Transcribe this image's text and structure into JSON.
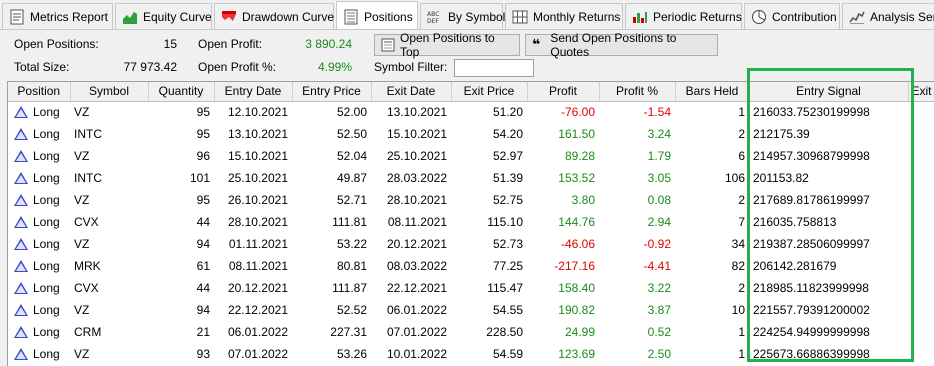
{
  "tabs": [
    {
      "label": "Metrics Report",
      "icon": "report-icon"
    },
    {
      "label": "Equity Curve",
      "icon": "equity-curve-icon"
    },
    {
      "label": "Drawdown Curve",
      "icon": "drawdown-curve-icon"
    },
    {
      "label": "Positions",
      "icon": "positions-icon",
      "active": true
    },
    {
      "label": "By Symbol",
      "icon": "abc-icon"
    },
    {
      "label": "Monthly Returns",
      "icon": "calendar-grid-icon"
    },
    {
      "label": "Periodic Returns",
      "icon": "periodic-returns-icon"
    },
    {
      "label": "Contribution",
      "icon": "pie-icon"
    },
    {
      "label": "Analysis Seri",
      "icon": "analysis-series-icon"
    }
  ],
  "summary": {
    "open_positions_label": "Open Positions:",
    "open_positions_value": "15",
    "total_size_label": "Total Size:",
    "total_size_value": "77 973.42",
    "open_profit_label": "Open Profit:",
    "open_profit_value": "3 890.24",
    "open_profit_pct_label": "Open Profit %:",
    "open_profit_pct_value": "4.99%",
    "symbol_filter_label": "Symbol Filter:",
    "symbol_filter_value": ""
  },
  "buttons": {
    "open_to_top": "Open Positions to Top",
    "send_to_quotes": "Send Open Positions to Quotes"
  },
  "columns": [
    "Position",
    "Symbol",
    "Quantity",
    "Entry Date",
    "Entry Price",
    "Exit Date",
    "Exit Price",
    "Profit",
    "Profit %",
    "Bars Held",
    "Entry Signal",
    "Exit Signal"
  ],
  "rows": [
    {
      "position": "Long",
      "symbol": "VZ",
      "quantity": "95",
      "entry_date": "12.10.2021",
      "entry_price": "52.00",
      "exit_date": "13.10.2021",
      "exit_price": "51.20",
      "profit": "-76.00",
      "profit_pct": "-1.54",
      "bars_held": "1",
      "entry_signal": "216033.75230199998",
      "sign": "neg"
    },
    {
      "position": "Long",
      "symbol": "INTC",
      "quantity": "95",
      "entry_date": "13.10.2021",
      "entry_price": "52.50",
      "exit_date": "15.10.2021",
      "exit_price": "54.20",
      "profit": "161.50",
      "profit_pct": "3.24",
      "bars_held": "2",
      "entry_signal": "212175.39",
      "sign": "pos"
    },
    {
      "position": "Long",
      "symbol": "VZ",
      "quantity": "96",
      "entry_date": "15.10.2021",
      "entry_price": "52.04",
      "exit_date": "25.10.2021",
      "exit_price": "52.97",
      "profit": "89.28",
      "profit_pct": "1.79",
      "bars_held": "6",
      "entry_signal": "214957.30968799998",
      "sign": "pos"
    },
    {
      "position": "Long",
      "symbol": "INTC",
      "quantity": "101",
      "entry_date": "25.10.2021",
      "entry_price": "49.87",
      "exit_date": "28.03.2022",
      "exit_price": "51.39",
      "profit": "153.52",
      "profit_pct": "3.05",
      "bars_held": "106",
      "entry_signal": "201153.82",
      "sign": "pos"
    },
    {
      "position": "Long",
      "symbol": "VZ",
      "quantity": "95",
      "entry_date": "26.10.2021",
      "entry_price": "52.71",
      "exit_date": "28.10.2021",
      "exit_price": "52.75",
      "profit": "3.80",
      "profit_pct": "0.08",
      "bars_held": "2",
      "entry_signal": "217689.81786199997",
      "sign": "pos"
    },
    {
      "position": "Long",
      "symbol": "CVX",
      "quantity": "44",
      "entry_date": "28.10.2021",
      "entry_price": "111.81",
      "exit_date": "08.11.2021",
      "exit_price": "115.10",
      "profit": "144.76",
      "profit_pct": "2.94",
      "bars_held": "7",
      "entry_signal": "216035.758813",
      "sign": "pos"
    },
    {
      "position": "Long",
      "symbol": "VZ",
      "quantity": "94",
      "entry_date": "01.11.2021",
      "entry_price": "53.22",
      "exit_date": "20.12.2021",
      "exit_price": "52.73",
      "profit": "-46.06",
      "profit_pct": "-0.92",
      "bars_held": "34",
      "entry_signal": "219387.28506099997",
      "sign": "neg"
    },
    {
      "position": "Long",
      "symbol": "MRK",
      "quantity": "61",
      "entry_date": "08.11.2021",
      "entry_price": "80.81",
      "exit_date": "08.03.2022",
      "exit_price": "77.25",
      "profit": "-217.16",
      "profit_pct": "-4.41",
      "bars_held": "82",
      "entry_signal": "206142.281679",
      "sign": "neg"
    },
    {
      "position": "Long",
      "symbol": "CVX",
      "quantity": "44",
      "entry_date": "20.12.2021",
      "entry_price": "111.87",
      "exit_date": "22.12.2021",
      "exit_price": "115.47",
      "profit": "158.40",
      "profit_pct": "3.22",
      "bars_held": "2",
      "entry_signal": "218985.11823999998",
      "sign": "pos"
    },
    {
      "position": "Long",
      "symbol": "VZ",
      "quantity": "94",
      "entry_date": "22.12.2021",
      "entry_price": "52.52",
      "exit_date": "06.01.2022",
      "exit_price": "54.55",
      "profit": "190.82",
      "profit_pct": "3.87",
      "bars_held": "10",
      "entry_signal": "221557.79391200002",
      "sign": "pos"
    },
    {
      "position": "Long",
      "symbol": "CRM",
      "quantity": "21",
      "entry_date": "06.01.2022",
      "entry_price": "227.31",
      "exit_date": "07.01.2022",
      "exit_price": "228.50",
      "profit": "24.99",
      "profit_pct": "0.52",
      "bars_held": "1",
      "entry_signal": "224254.94999999998",
      "sign": "pos"
    },
    {
      "position": "Long",
      "symbol": "VZ",
      "quantity": "93",
      "entry_date": "07.01.2022",
      "entry_price": "53.26",
      "exit_date": "10.01.2022",
      "exit_price": "54.59",
      "profit": "123.69",
      "profit_pct": "2.50",
      "bars_held": "1",
      "entry_signal": "225673.66886399998",
      "sign": "pos"
    }
  ],
  "colors": {
    "positive": "#1a8a1a",
    "negative": "#e00000",
    "highlight": "#22b14c",
    "long_marker": "#3a47c9"
  }
}
